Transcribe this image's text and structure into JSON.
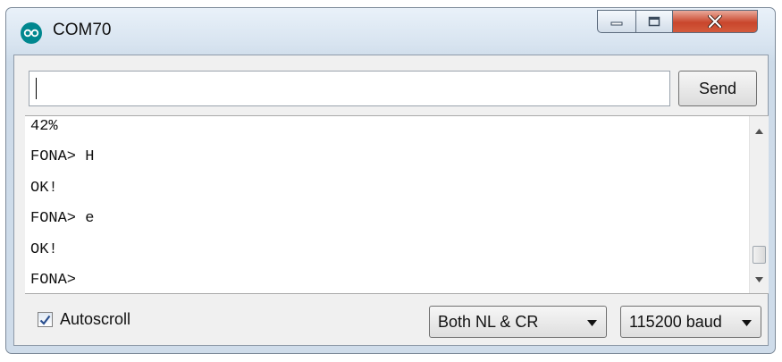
{
  "window": {
    "title": "COM70",
    "icon": "arduino-infinity-icon",
    "controls": [
      "minimize-icon",
      "maximize-icon",
      "close-icon"
    ]
  },
  "input": {
    "value": "",
    "send_label": "Send"
  },
  "output": {
    "lines": [
      "42%",
      "FONA> H",
      "OK!",
      "FONA> e",
      "OK!",
      "FONA>"
    ]
  },
  "footer": {
    "autoscroll_label": "Autoscroll",
    "autoscroll_checked": true,
    "line_ending": "Both NL & CR",
    "baud_rate": "115200 baud"
  },
  "colors": {
    "close_button": "#c9462c",
    "app_icon": "#00878f"
  }
}
